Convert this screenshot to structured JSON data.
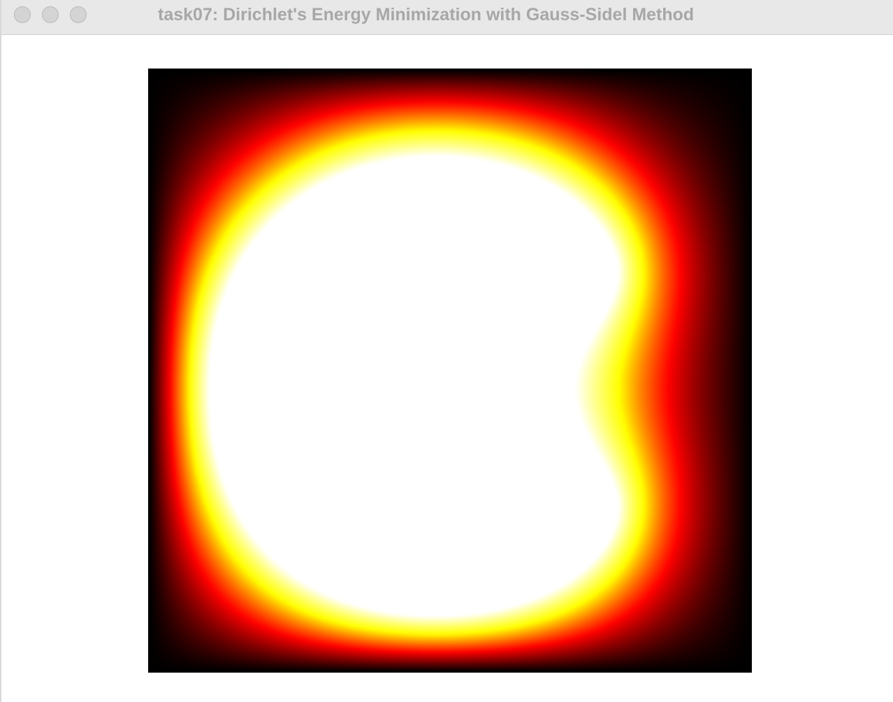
{
  "window": {
    "title": "task07: Dirichlet's Energy Minimization with Gauss-Sidel Method",
    "buttons": {
      "close": "close-button",
      "minimize": "minimize-button",
      "zoom": "zoom-button"
    }
  },
  "visualization": {
    "colormap": [
      "#000000",
      "#ff0000",
      "#ffff00",
      "#ffffff"
    ],
    "description_icon": "heatmap-canvas"
  }
}
